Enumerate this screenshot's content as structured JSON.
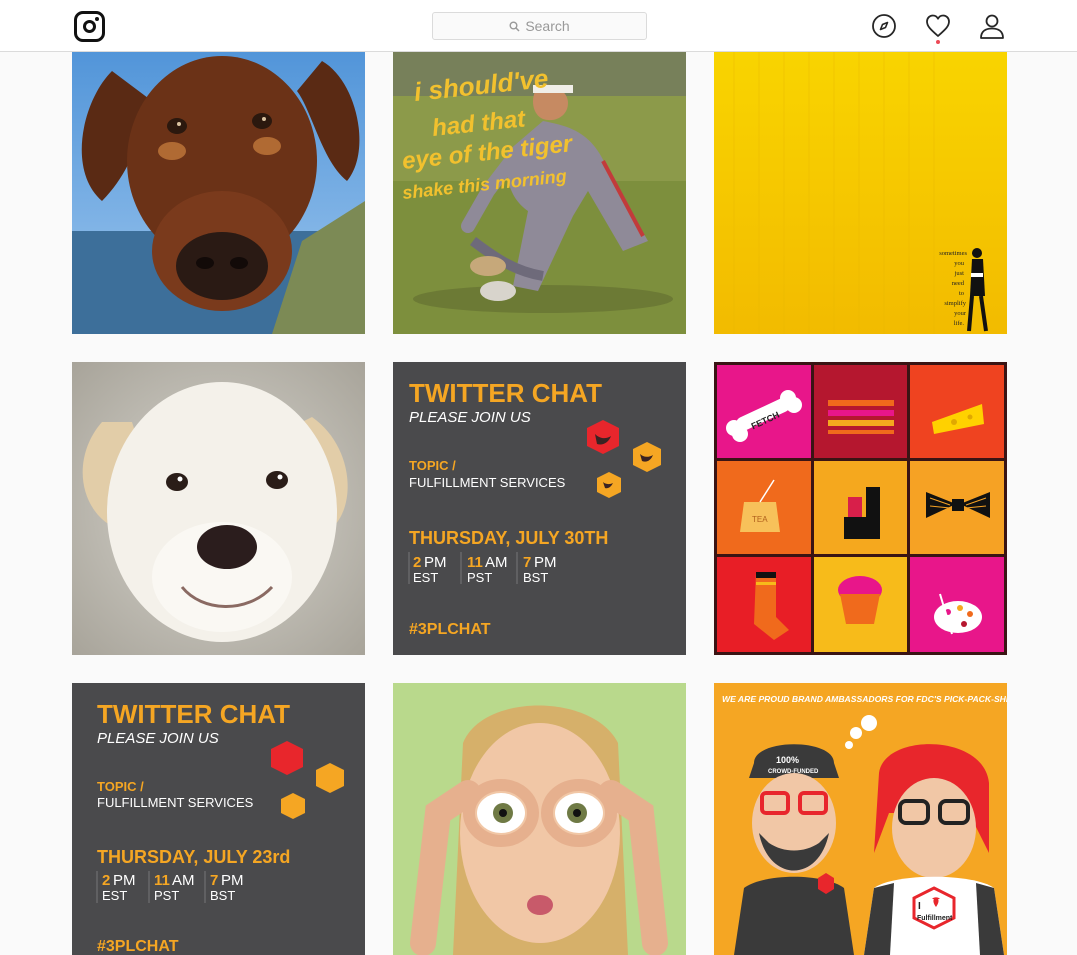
{
  "header": {
    "logo_icon": "instagram-logo-icon",
    "search_placeholder": "Search",
    "icons": [
      "compass-icon",
      "heart-icon",
      "profile-icon"
    ],
    "notification_dot_color": "#ed4956"
  },
  "posts": [
    {
      "alt_icon": "doberman-dog-photo"
    },
    {
      "text": [
        "i should've",
        "had that",
        "eye of the tiger",
        "shake this morning"
      ]
    },
    {
      "text": [
        "sometimes",
        "you",
        "just",
        "need",
        "to",
        "simplify",
        "your",
        "life."
      ]
    },
    {
      "alt_icon": "white-puppy-photo"
    },
    {
      "title": "TWITTER CHAT",
      "subtitle": "PLEASE JOIN US",
      "topic_label": "TOPIC /",
      "topic": "FULFILLMENT SERVICES",
      "date": "THURSDAY, JULY 30TH",
      "times": [
        {
          "num": "2",
          "unit": "PM",
          "zone": "EST"
        },
        {
          "num": "11",
          "unit": "AM",
          "zone": "PST"
        },
        {
          "num": "7",
          "unit": "PM",
          "zone": "BST"
        }
      ],
      "hashtag": "#3PLCHAT"
    },
    {
      "labels": [
        "FETCH",
        "TEA"
      ]
    },
    {
      "title": "TWITTER CHAT",
      "subtitle": "PLEASE JOIN US",
      "topic_label": "TOPIC /",
      "topic": "FULFILLMENT SERVICES",
      "date": "THURSDAY, JULY 23rd",
      "times": [
        {
          "num": "2",
          "unit": "PM",
          "zone": "EST"
        },
        {
          "num": "11",
          "unit": "AM",
          "zone": "PST"
        },
        {
          "num": "7",
          "unit": "PM",
          "zone": "BST"
        }
      ],
      "hashtag": "#3PLCHAT"
    },
    {
      "alt_icon": "woman-goggles-hands-photo"
    },
    {
      "banner": "WE ARE PROUD BRAND AMBASSADORS FOR FDC'S PICK-PACK-SHIP SERVICES!",
      "cap_text": [
        "100%",
        "CROWD-FUNDED"
      ],
      "shirt_text": [
        "I",
        "Fulfillment"
      ]
    }
  ],
  "colors": {
    "chat_bg": "#4a4a4c",
    "chat_orange": "#f5a623",
    "chat_red": "#e8262c",
    "yellow_bg": "#f7c600",
    "comic_bg": "#f5a623"
  }
}
